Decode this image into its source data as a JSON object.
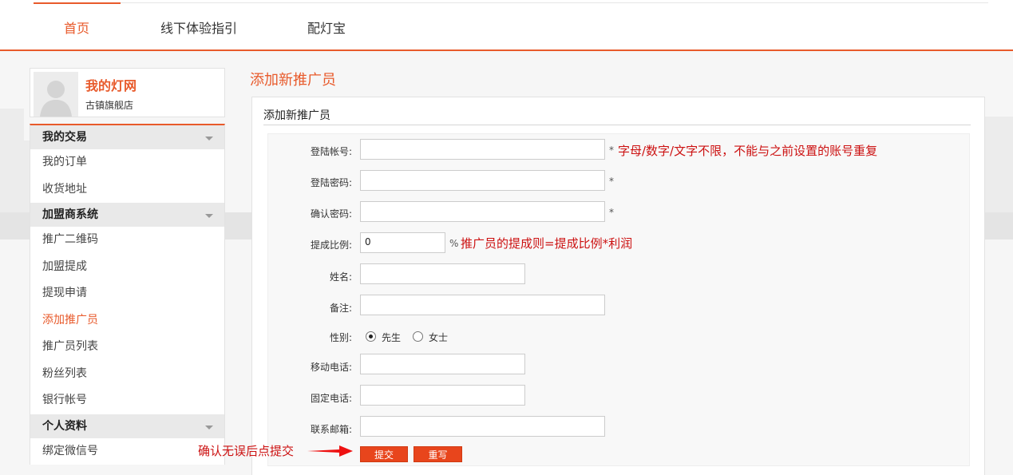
{
  "nav": {
    "items": [
      {
        "label": "首页"
      },
      {
        "label": "线下体验指引"
      },
      {
        "label": "配灯宝"
      }
    ]
  },
  "profile": {
    "name": "我的灯网",
    "shop": "古镇旗舰店"
  },
  "sidebar": {
    "groups": [
      {
        "label": "我的交易",
        "items": [
          "我的订单",
          "收货地址"
        ]
      },
      {
        "label": "加盟商系统",
        "items": [
          "推广二维码",
          "加盟提成",
          "提现申请",
          "添加推广员",
          "推广员列表",
          "粉丝列表",
          "银行帐号"
        ]
      },
      {
        "label": "个人资料",
        "items": [
          "绑定微信号"
        ]
      }
    ]
  },
  "page": {
    "title": "添加新推广员",
    "panel_title": "添加新推广员"
  },
  "form": {
    "account": {
      "label": "登陆帐号:",
      "value": "",
      "required": "*",
      "hint": "字母/数字/文字不限，不能与之前设置的账号重复"
    },
    "password": {
      "label": "登陆密码:",
      "value": "",
      "required": "*"
    },
    "confirm": {
      "label": "确认密码:",
      "value": "",
      "required": "*"
    },
    "ratio": {
      "label": "提成比例:",
      "value": "0",
      "unit": "%",
      "hint": "推广员的提成则=提成比例*利润"
    },
    "name": {
      "label": "姓名:",
      "value": ""
    },
    "remark": {
      "label": "备注:",
      "value": ""
    },
    "gender": {
      "label": "性别:",
      "options": [
        "先生",
        "女士"
      ],
      "selected": "先生"
    },
    "mobile": {
      "label": "移动电话:",
      "value": ""
    },
    "phone": {
      "label": "固定电话:",
      "value": ""
    },
    "email": {
      "label": "联系邮箱:",
      "value": ""
    },
    "submit_label": "提交",
    "reset_label": "重写"
  },
  "annotation": {
    "text": "确认无误后点提交"
  },
  "colors": {
    "accent": "#e85a2b",
    "hint": "#cc1111",
    "button": "#e8451c"
  }
}
